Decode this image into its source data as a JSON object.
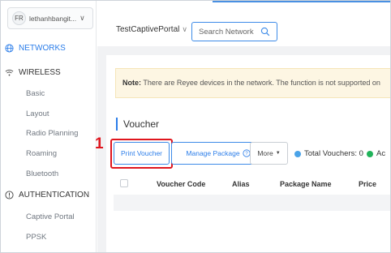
{
  "user": {
    "avatar_initials": "FR",
    "name": "lethanhbangit..."
  },
  "nav": {
    "networks": "NETWORKS",
    "wireless": "WIRELESS",
    "wireless_items": [
      "Basic",
      "Layout",
      "Radio Planning",
      "Roaming",
      "Bluetooth"
    ],
    "authentication": "AUTHENTICATION",
    "auth_items": [
      "Captive Portal",
      "PPSK"
    ]
  },
  "topbar": {
    "portal_name": "TestCaptivePortal",
    "search_placeholder": "Search Network"
  },
  "notice": {
    "label": "Note:",
    "text": "There are Reyee devices in the network. The function is not supported on"
  },
  "section_title": "Voucher",
  "toolbar": {
    "print_voucher": "Print Voucher",
    "manage_package": "Manage Package",
    "more": "More",
    "total_vouchers": "Total Vouchers: 0",
    "active_label": "Ac"
  },
  "table": {
    "headers": [
      "Voucher Code",
      "Alias",
      "Package Name",
      "Price"
    ]
  },
  "annotation": {
    "step_number": "1"
  },
  "colors": {
    "accent": "#2b7de9",
    "highlight": "#e0161e",
    "total_dot": "#4aa3e8",
    "active_dot": "#21b35a"
  }
}
